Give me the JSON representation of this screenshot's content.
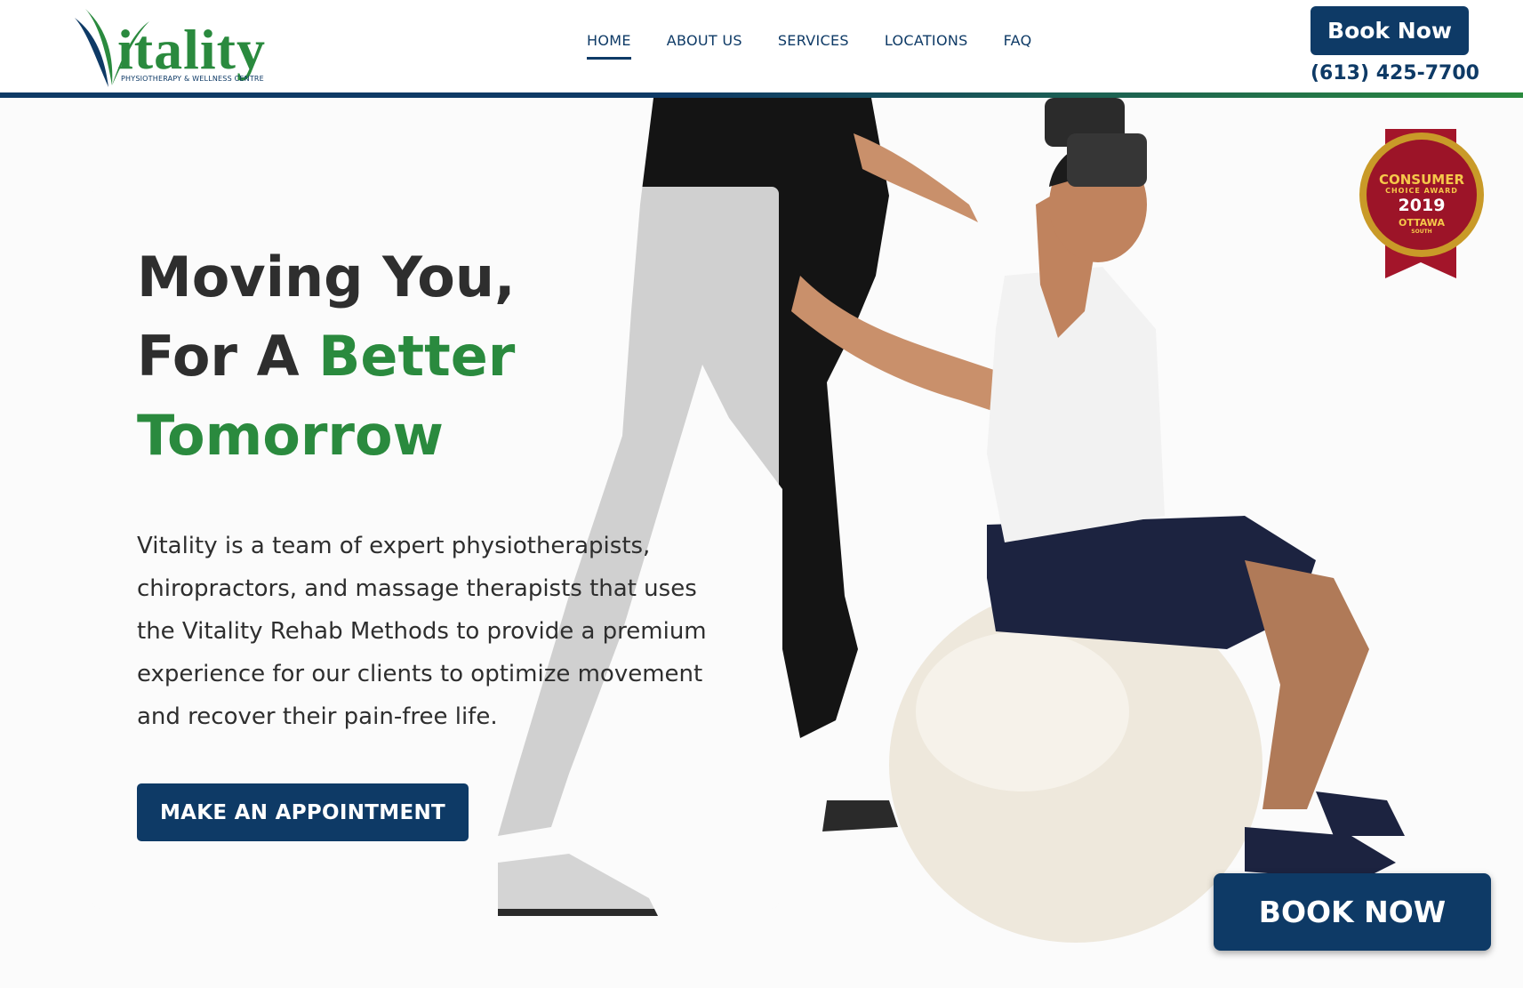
{
  "brand": {
    "name": "Vitality",
    "logo_word": "itality",
    "tagline": "PHYSIOTHERAPY & WELLNESS CENTRE",
    "primary_color": "#0e3a66",
    "accent_color": "#2a8a3e"
  },
  "nav": {
    "items": [
      {
        "label": "HOME",
        "active": true
      },
      {
        "label": "ABOUT US",
        "active": false
      },
      {
        "label": "SERVICES",
        "active": false
      },
      {
        "label": "LOCATIONS",
        "active": false
      },
      {
        "label": "FAQ",
        "active": false
      }
    ]
  },
  "header": {
    "book_label": "Book Now",
    "phone": "(613) 425-7700"
  },
  "hero": {
    "headline_line1": "Moving You,",
    "headline_line2_dark": "For A ",
    "headline_line2_green": "Better",
    "headline_line3_green": "Tomorrow",
    "description": "Vitality is a team of expert physiotherapists, chiropractors, and massage therapists that uses the Vitality Rehab Methods to provide a premium experience for our clients to optimize movement and recover their pain-free life.",
    "cta_label": "MAKE AN APPOINTMENT"
  },
  "award": {
    "line1": "CONSUMER",
    "line2": "CHOICE AWARD",
    "year": "2019",
    "city": "OTTAWA",
    "region": "SOUTH"
  },
  "floating": {
    "book_label": "BOOK NOW"
  }
}
